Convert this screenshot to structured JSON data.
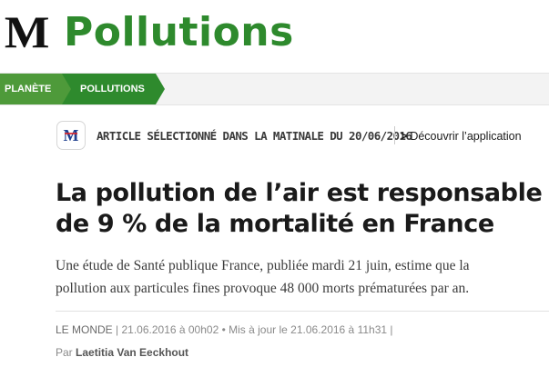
{
  "header": {
    "logo": "M",
    "section_title": "Pollutions"
  },
  "breadcrumb": {
    "items": [
      {
        "label": "PLANÈTE",
        "color": "#4e9a3a"
      },
      {
        "label": "POLLUTIONS",
        "color": "#2e8a2d"
      }
    ]
  },
  "matinale": {
    "label": "ARTICLE SÉLECTIONNÉ DANS LA MATINALE DU 20/06/2016",
    "link_chevron": ">",
    "link_label": "Découvrir l’application",
    "icon": "le-monde-app-icon"
  },
  "article": {
    "headline_line1": "La pollution de l’air est responsable",
    "headline_line2": "de 9 % de la mortalité en France",
    "summary_line1": "Une étude de Santé publique France, publiée mardi 21 juin, estime que la",
    "summary_line2": "pollution aux particules fines provoque 48 000 morts prématurées par an.",
    "meta": {
      "source": "LE MONDE",
      "sep1": " | ",
      "date": "21.06.2016 à 00h02",
      "bullet": " • ",
      "updated": "Mis à jour le 21.06.2016 à 11h31",
      "sep2": " |"
    },
    "byline": {
      "prefix": "Par ",
      "author": "Laetitia Van Eeckhout"
    }
  },
  "colors": {
    "brand_green": "#2e8a2d",
    "crumb_light_green": "#4e9a3a"
  }
}
